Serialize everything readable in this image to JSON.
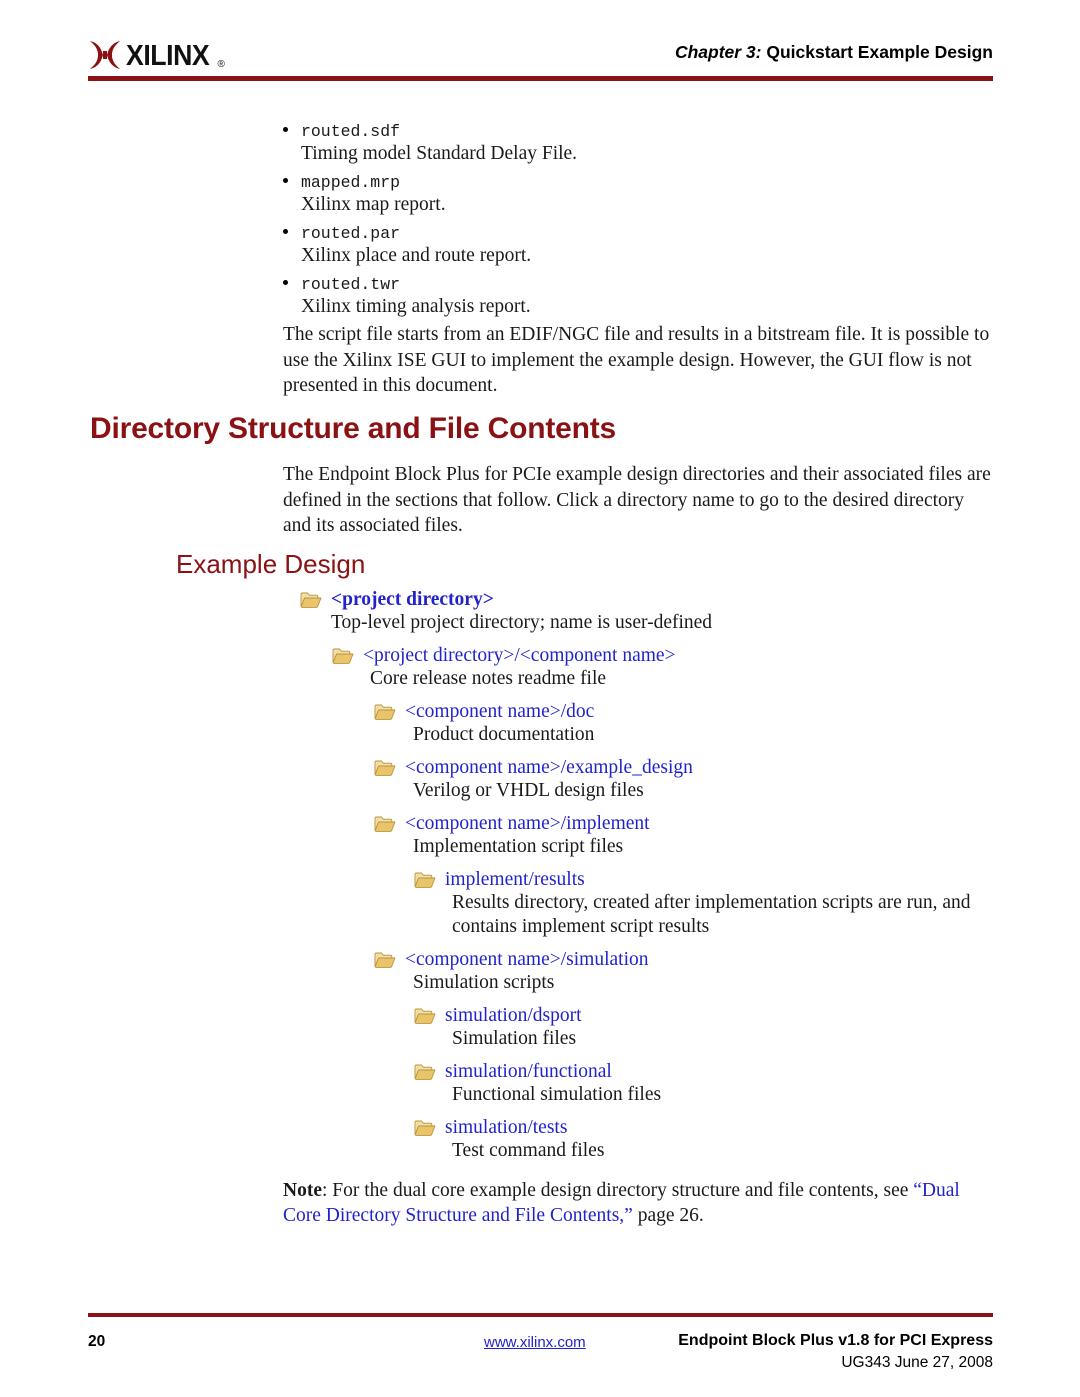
{
  "header": {
    "logo_word": "XILINX",
    "logo_reg": "®",
    "chapter_num": "Chapter 3:",
    "chapter_title": "Quickstart Example Design",
    "rule_color": "#8a1114"
  },
  "bullets": [
    {
      "file": "routed.sdf",
      "desc": "Timing model Standard Delay File."
    },
    {
      "file": "mapped.mrp",
      "desc": "Xilinx map report."
    },
    {
      "file": "routed.par",
      "desc": "Xilinx place and route report."
    },
    {
      "file": "routed.twr",
      "desc": "Xilinx timing analysis report."
    }
  ],
  "intro_paragraph": "The script file starts from an EDIF/NGC file and results in a bitstream file. It is possible to use the Xilinx ISE GUI to implement the example design. However, the GUI flow is not presented in this document.",
  "heading1": "Directory Structure and File Contents",
  "section_paragraph": "The Endpoint Block Plus for PCIe example design directories and their associated files are defined in the sections that follow. Click a directory name to go to the desired directory and its associated files.",
  "heading2": "Example Design",
  "tree": [
    {
      "label": "<project directory>",
      "desc": "Top-level project directory; name is user-defined",
      "level": 0,
      "bold": true,
      "icon": "folder-icon"
    },
    {
      "label": "<project directory>/<component name>",
      "desc": "Core release notes readme file",
      "level": 1,
      "bold": false,
      "icon": "folder-icon"
    },
    {
      "label": "<component name>/doc",
      "desc": "Product documentation",
      "level": 2,
      "bold": false,
      "icon": "folder-icon"
    },
    {
      "label": "<component name>/example_design",
      "desc": "Verilog or VHDL design files",
      "level": 2,
      "bold": false,
      "icon": "folder-icon"
    },
    {
      "label": "<component name>/implement",
      "desc": "Implementation script files",
      "level": 2,
      "bold": false,
      "icon": "folder-icon"
    },
    {
      "label": "implement/results",
      "desc": "Results directory, created after implementation scripts are run, and contains implement script results",
      "level": 3,
      "bold": false,
      "icon": "folder-icon"
    },
    {
      "label": "<component name>/simulation",
      "desc": "Simulation scripts",
      "level": 2,
      "bold": false,
      "icon": "folder-icon"
    },
    {
      "label": "simulation/dsport",
      "desc": "Simulation files",
      "level": 3,
      "bold": false,
      "icon": "folder-icon"
    },
    {
      "label": "simulation/functional",
      "desc": "Functional simulation files",
      "level": 3,
      "bold": false,
      "icon": "folder-icon"
    },
    {
      "label": "simulation/tests",
      "desc": "Test command files",
      "level": 3,
      "bold": false,
      "icon": "folder-icon"
    }
  ],
  "note": {
    "label": "Note",
    "text_before": ": For the dual core example design directory structure and file contents, see ",
    "link": "“Dual Core Directory Structure and File Contents,”",
    "text_after": " page 26."
  },
  "footer": {
    "page_number": "20",
    "website": "www.xilinx.com",
    "doc_title": "Endpoint Block Plus v1.8 for PCI Express",
    "doc_id": "UG343 June 27, 2008"
  },
  "colors": {
    "brand_red": "#8a1114",
    "link_blue": "#2222cc",
    "text_black": "#1a1a1a",
    "folder_tan": "#e8c36a"
  }
}
